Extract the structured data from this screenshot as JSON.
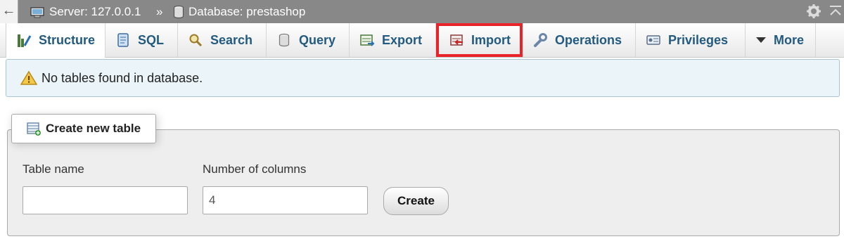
{
  "breadcrumb": {
    "back_glyph": "←",
    "server_label": "Server: 127.0.0.1",
    "separator": "»",
    "database_label": "Database: prestashop"
  },
  "tabs": [
    {
      "label": "Structure",
      "icon": "structure-icon",
      "active": true
    },
    {
      "label": "SQL",
      "icon": "sql-icon"
    },
    {
      "label": "Search",
      "icon": "search-icon"
    },
    {
      "label": "Query",
      "icon": "query-icon"
    },
    {
      "label": "Export",
      "icon": "export-icon"
    },
    {
      "label": "Import",
      "icon": "import-icon",
      "highlighted": true
    },
    {
      "label": "Operations",
      "icon": "wrench-icon"
    },
    {
      "label": "Privileges",
      "icon": "privileges-icon"
    },
    {
      "label": "More",
      "icon": "caret-down-icon"
    }
  ],
  "notice": {
    "text": "No tables found in database.",
    "icon": "warning-icon"
  },
  "create_table": {
    "legend": "Create new table",
    "table_name_label": "Table name",
    "table_name_value": "",
    "columns_label": "Number of columns",
    "columns_value": "4",
    "create_button": "Create"
  },
  "colors": {
    "tab_text": "#235a81",
    "highlight_outline": "#e8242a",
    "notice_bg": "#ebf4f8",
    "topbar_bg": "#888888"
  }
}
